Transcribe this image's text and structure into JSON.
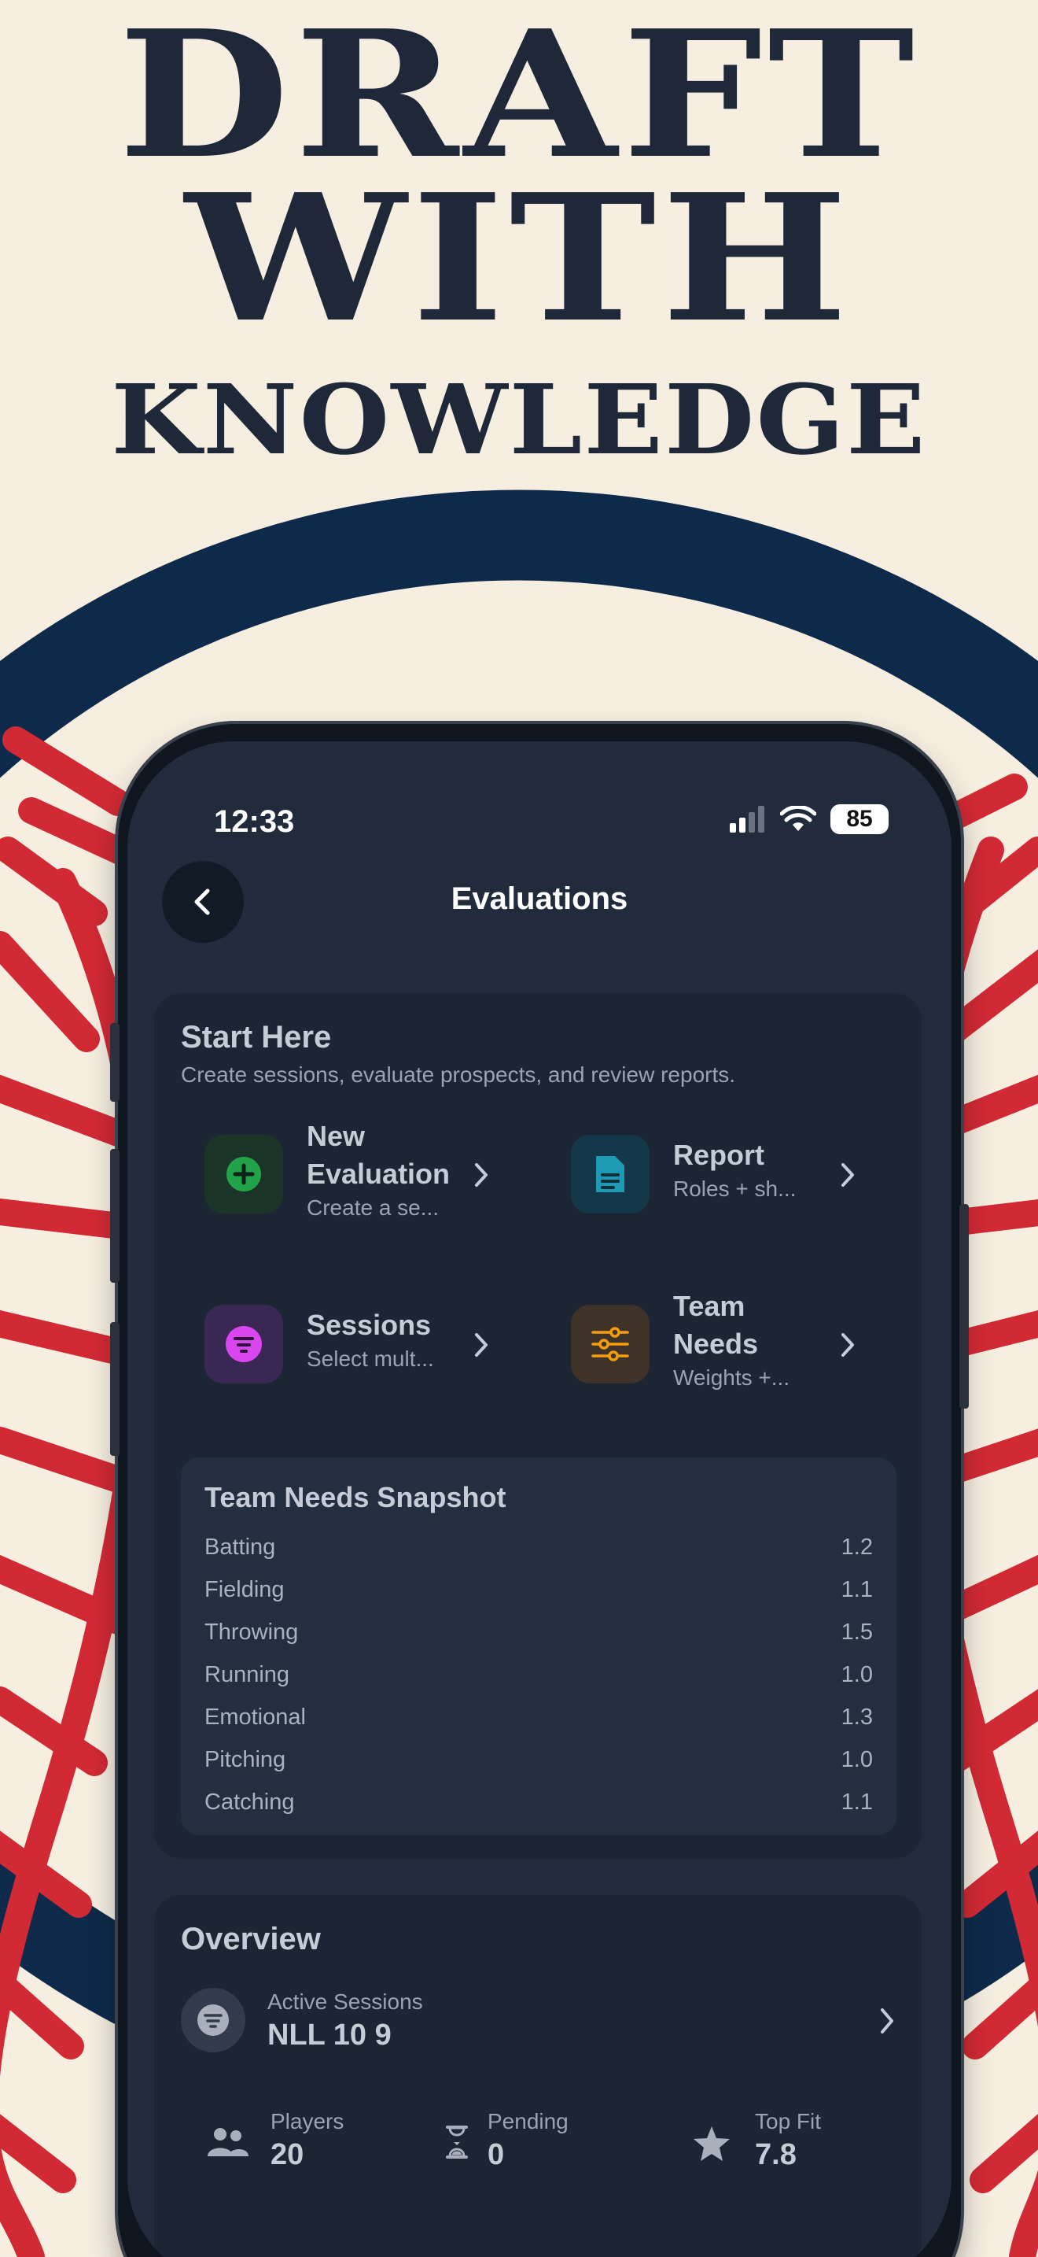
{
  "headline": {
    "line1": "DRAFT",
    "line2": "WITH",
    "line3": "KNOWLEDGE"
  },
  "status_bar": {
    "time": "12:33",
    "battery": "85",
    "icons": [
      "cellular-signal-icon",
      "wifi-icon",
      "battery-icon"
    ]
  },
  "nav": {
    "back_icon": "chevron-left-icon",
    "title": "Evaluations"
  },
  "start_here": {
    "title": "Start Here",
    "subtitle": "Create sessions, evaluate prospects, and review reports.",
    "tiles": [
      {
        "title_line1": "New",
        "title_line2": "Evaluation",
        "subtitle": "Create a se...",
        "icon": "plus-circle-icon",
        "color": "#22a34a"
      },
      {
        "title_line1": "Report",
        "title_line2": "",
        "subtitle": "Roles + sh...",
        "icon": "document-icon",
        "color": "#1e9bb4"
      },
      {
        "title_line1": "Sessions",
        "title_line2": "",
        "subtitle": "Select mult...",
        "icon": "filter-circle-icon",
        "color": "#d946ef"
      },
      {
        "title_line1": "Team",
        "title_line2": "Needs",
        "subtitle": "Weights +...",
        "icon": "sliders-icon",
        "color": "#f59e0b"
      }
    ]
  },
  "team_needs_snapshot": {
    "title": "Team Needs Snapshot",
    "rows": [
      {
        "label": "Batting",
        "value": "1.2"
      },
      {
        "label": "Fielding",
        "value": "1.1"
      },
      {
        "label": "Throwing",
        "value": "1.5"
      },
      {
        "label": "Running",
        "value": "1.0"
      },
      {
        "label": "Emotional",
        "value": "1.3"
      },
      {
        "label": "Pitching",
        "value": "1.0"
      },
      {
        "label": "Catching",
        "value": "1.1"
      }
    ]
  },
  "overview": {
    "title": "Overview",
    "active_sessions_label": "Active Sessions",
    "active_sessions_value": "NLL 10 9",
    "stats": [
      {
        "label": "Players",
        "value": "20",
        "icon": "people-icon"
      },
      {
        "label": "Pending",
        "value": "0",
        "icon": "hourglass-icon"
      },
      {
        "label": "Top Fit",
        "value": "7.8",
        "icon": "star-icon"
      }
    ]
  },
  "colors": {
    "poster_bg": "#f6efe1",
    "headline": "#1e2838",
    "navy_ring": "#0e2a4a",
    "red_art": "#d22a35",
    "screen_bg": "#212b3b"
  }
}
